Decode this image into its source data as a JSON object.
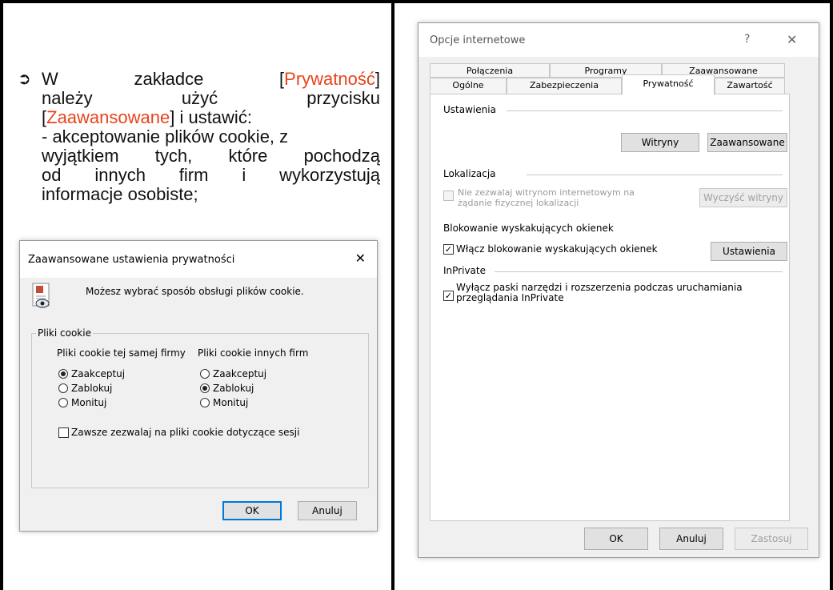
{
  "instruction": {
    "line1_pre": "W zakładce [",
    "line1_highlight": "Prywatność",
    "line1_post": "]",
    "line2": "należy użyć przycisku",
    "line3_pre": "[",
    "line3_highlight": "Zaawansowane",
    "line3_post": "] i ustawić:",
    "line4": "- akceptowanie plików cookie, z",
    "line5": "wyjątkiem tych, które pochodzą",
    "line6": "od innych firm i wykorzystują",
    "line7": "informacje osobiste;",
    "highlight_color": "#e8431b"
  },
  "advanced_dialog": {
    "title": "Zaawansowane ustawienia prywatności",
    "close": "✕",
    "description": "Możesz wybrać sposób obsługi plików cookie.",
    "group_label": "Pliki cookie",
    "first_party_header": "Pliki cookie tej samej firmy",
    "third_party_header": "Pliki cookie innych firm",
    "options": [
      "Zaakceptuj",
      "Zablokuj",
      "Monituj"
    ],
    "first_party_selected": "Zaakceptuj",
    "third_party_selected": "Zablokuj",
    "session_checkbox": "Zawsze zezwalaj na pliki cookie dotyczące sesji",
    "ok": "OK",
    "cancel": "Anuluj"
  },
  "internet_options": {
    "title": "Opcje internetowe",
    "help": "?",
    "close": "✕",
    "tabs_top": [
      "Połączenia",
      "Programy",
      "Zaawansowane"
    ],
    "tabs_bottom": [
      "Ogólne",
      "Zabezpieczenia",
      "Prywatność",
      "Zawartość"
    ],
    "active_tab": "Prywatność",
    "settings_label": "Ustawienia",
    "sites_button": "Witryny",
    "advanced_button": "Zaawansowane",
    "location_label": "Lokalizacja",
    "location_checkbox_line1": "Nie zezwalaj witrynom internetowym na",
    "location_checkbox_line2": "żądanie fizycznej lokalizacji",
    "clear_sites_button": "Wyczyść witryny",
    "popup_label": "Blokowanie wyskakujących okienek",
    "popup_checkbox": "Włącz blokowanie wyskakujących okienek",
    "popup_settings_button": "Ustawienia",
    "inprivate_label": "InPrivate",
    "inprivate_checkbox_line1": "Wyłącz paski narzędzi i rozszerzenia podczas uruchamiania",
    "inprivate_checkbox_line2": "przeglądania InPrivate",
    "ok": "OK",
    "cancel": "Anuluj",
    "apply": "Zastosuj"
  }
}
